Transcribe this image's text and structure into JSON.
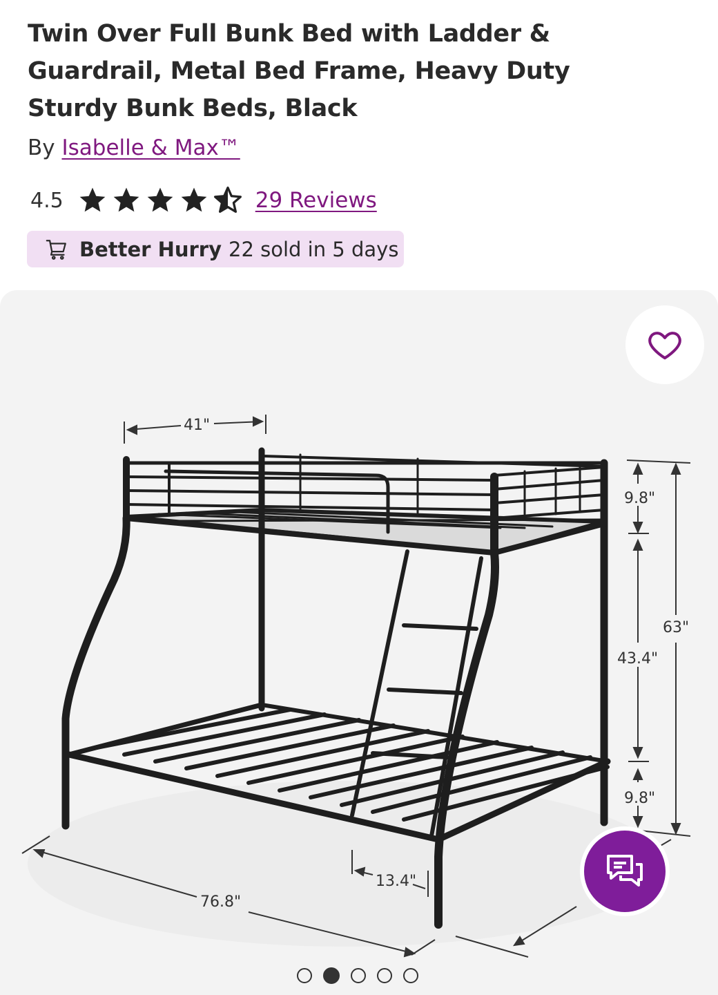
{
  "product": {
    "title": "Twin Over Full Bunk Bed with Ladder & Guardrail, Metal Bed Frame, Heavy Duty Sturdy Bunk Beds, Black",
    "by_prefix": "By",
    "brand": "Isabelle & Max™"
  },
  "rating": {
    "value": "4.5",
    "stars": 4.5,
    "max_stars": 5,
    "reviews_label": "29 Reviews"
  },
  "urgency": {
    "icon": "cart-icon",
    "strong": "Better Hurry",
    "text": "22 sold in 5 days"
  },
  "gallery": {
    "image_index": 2,
    "image_count": 5,
    "dimensions": {
      "width": "41\"",
      "top_rail": "9.8\"",
      "total_height": "63\"",
      "clearance": "43.4\"",
      "bottom_rail": "9.8\"",
      "length": "76.8\"",
      "ladder_offset": "13.4\""
    }
  },
  "icons": {
    "favorite": "heart-icon",
    "chat": "chat-bubbles-icon"
  },
  "colors": {
    "accent": "#7f187f",
    "chat_button": "#7f1d9a",
    "badge_bg": "#f1dff3",
    "gallery_bg": "#f3f3f3"
  }
}
